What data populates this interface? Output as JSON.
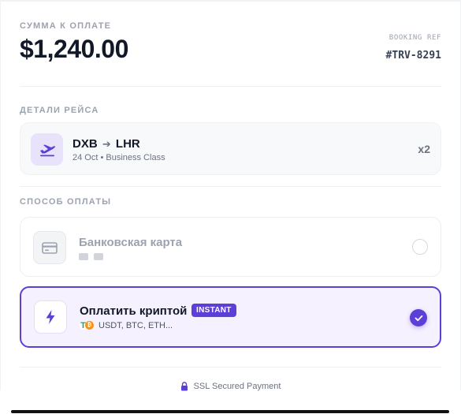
{
  "summary": {
    "amount_label": "СУММА К ОПЛАТЕ",
    "amount": "$1,240.00",
    "booking_ref_label": "BOOKING REF",
    "booking_ref": "#TRV-8291"
  },
  "flight": {
    "section_label": "ДЕТАЛИ РЕЙСА",
    "from": "DXB",
    "arrow": "➔",
    "to": "LHR",
    "details": "24 Oct • Business Class",
    "passengers": "x2",
    "icon": "plane-takeoff-icon"
  },
  "payment": {
    "section_label": "СПОСОБ ОПЛАТЫ",
    "card": {
      "title": "Банковская карта",
      "selected": false,
      "icon": "credit-card-icon"
    },
    "crypto": {
      "title": "Оплатить криптой",
      "badge": "INSTANT",
      "currencies": "USDT, BTC, ETH...",
      "coin_usdt": "T",
      "coin_btc": "₿",
      "selected": true,
      "icon": "lightning-icon"
    }
  },
  "footer": {
    "ssl_text": "SSL Secured Payment",
    "icon": "lock-icon"
  },
  "colors": {
    "accent": "#5b3fd6",
    "accent_light": "#f5f1ff",
    "text_muted": "#9ca3af"
  }
}
